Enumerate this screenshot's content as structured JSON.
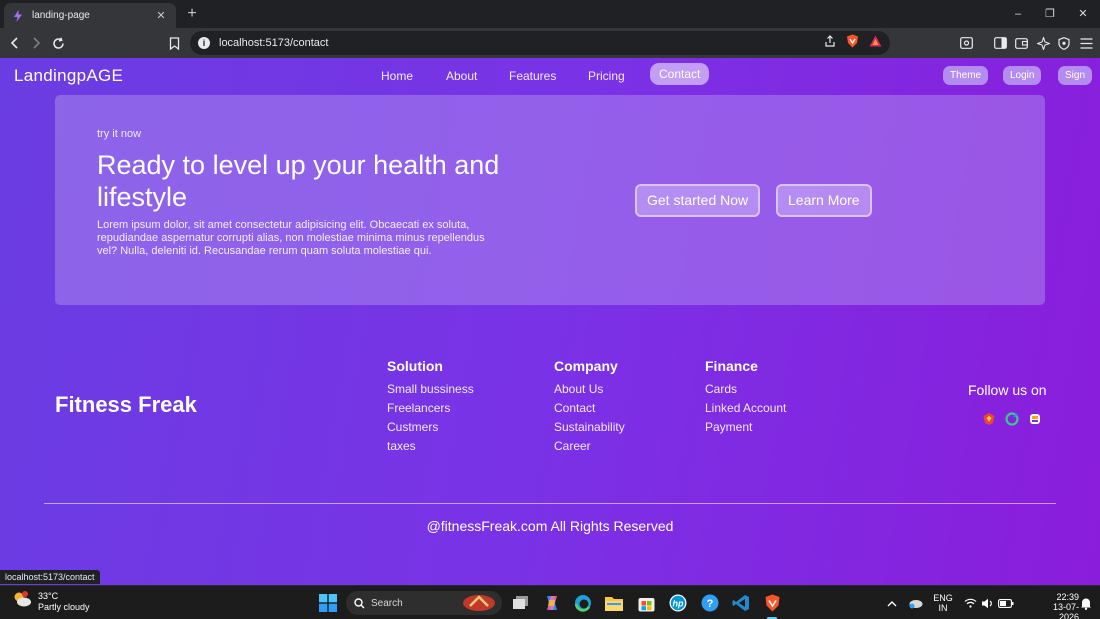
{
  "browser": {
    "tab_title": "landing-page",
    "tab_close": "✕",
    "new_tab": "+",
    "window_controls": {
      "minimize": "–",
      "maximize": "❐",
      "close": "✕"
    },
    "url": "localhost:5173/contact",
    "status_hover_url": "localhost:5173/contact"
  },
  "nav": {
    "brand": "LandingpAGE",
    "links": [
      "Home",
      "About",
      "Features",
      "Pricing",
      "Contact"
    ],
    "active_link": "Contact",
    "actions": [
      "Theme",
      "Login",
      "Sign"
    ]
  },
  "hero": {
    "eyebrow": "try it now",
    "title": "Ready to level up your health and lifestyle",
    "body": "Lorem ipsum dolor, sit amet consectetur adipisicing elit. Obcaecati ex soluta, repudiandae aspernatur corrupti alias, non molestiae minima minus repellendus vel? Nulla, deleniti id. Recusandae rerum quam soluta molestiae qui.",
    "primary_button": "Get started Now",
    "secondary_button": "Learn More"
  },
  "footer": {
    "brand": "Fitness Freak",
    "columns": [
      {
        "title": "Solution",
        "items": [
          "Small bussiness",
          "Freelancers",
          "Custmers",
          "taxes"
        ]
      },
      {
        "title": "Company",
        "items": [
          "About Us",
          "Contact",
          "Sustainability",
          "Career"
        ]
      },
      {
        "title": "Finance",
        "items": [
          "Cards",
          "Linked Account",
          "Payment"
        ]
      }
    ],
    "follow_label": "Follow us on",
    "socials": [
      "brand-icon-1",
      "brand-icon-2",
      "brand-icon-3"
    ],
    "copyright": "@fitnessFreak.com All Rights Reserved"
  },
  "taskbar": {
    "weather_temp": "33°C",
    "weather_desc": "Partly cloudy",
    "search_label": "Search",
    "lang_line1": "ENG",
    "lang_line2": "IN",
    "time": "22:39",
    "date": "13-07-2026"
  },
  "colors": {
    "page_gradient_start": "#6a3de2",
    "page_gradient_end": "#8a1ddc",
    "active_nav_pill": "#c39ef3",
    "chrome_dark": "#202124"
  }
}
